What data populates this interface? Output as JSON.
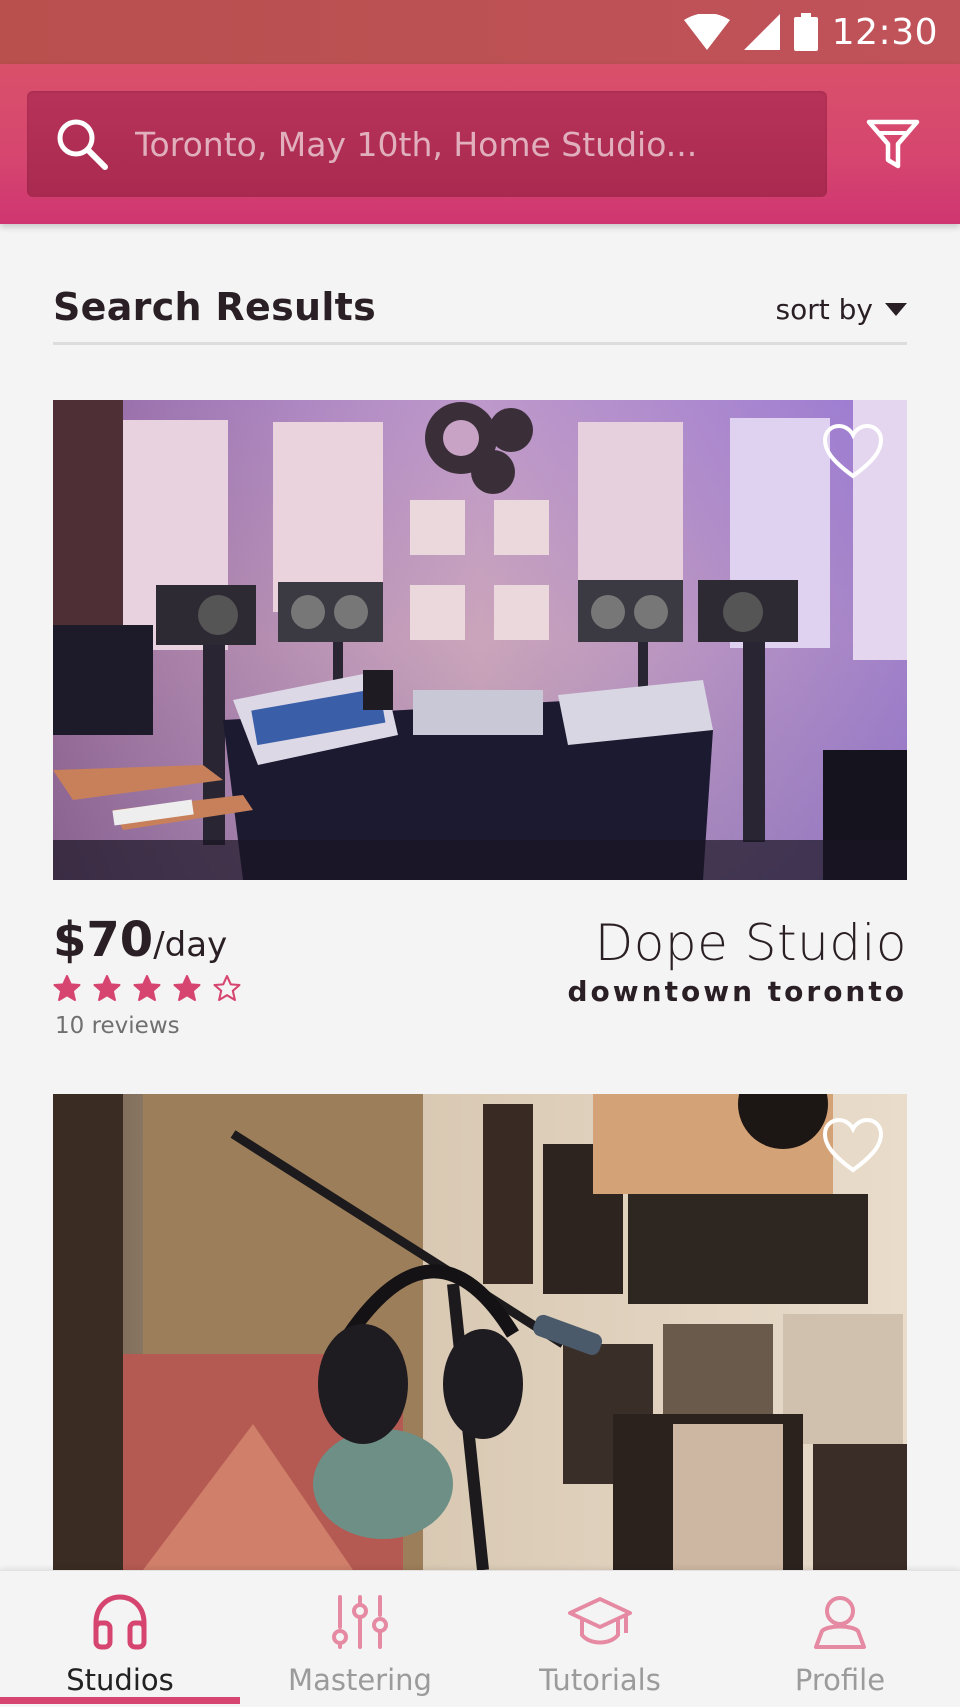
{
  "status_bar": {
    "time": "12:30"
  },
  "search": {
    "placeholder": "Toronto, May 10th, Home Studio..."
  },
  "results": {
    "title": "Search Results",
    "sort_label": "sort by"
  },
  "listings": [
    {
      "price": "$70",
      "price_unit": "/day",
      "rating": 4,
      "rating_max": 5,
      "reviews": "10 reviews",
      "name": "Dope Studio",
      "location": "downtown toronto"
    }
  ],
  "nav": {
    "items": [
      {
        "label": "Studios",
        "icon": "headphones-icon",
        "active": true
      },
      {
        "label": "Mastering",
        "icon": "mixer-sliders-icon",
        "active": false
      },
      {
        "label": "Tutorials",
        "icon": "graduation-cap-icon",
        "active": false
      },
      {
        "label": "Profile",
        "icon": "user-icon",
        "active": false
      }
    ]
  },
  "colors": {
    "accent": "#d6456f",
    "header_dark": "#a92a50",
    "star": "#d6456f",
    "text": "#2a1f24"
  }
}
